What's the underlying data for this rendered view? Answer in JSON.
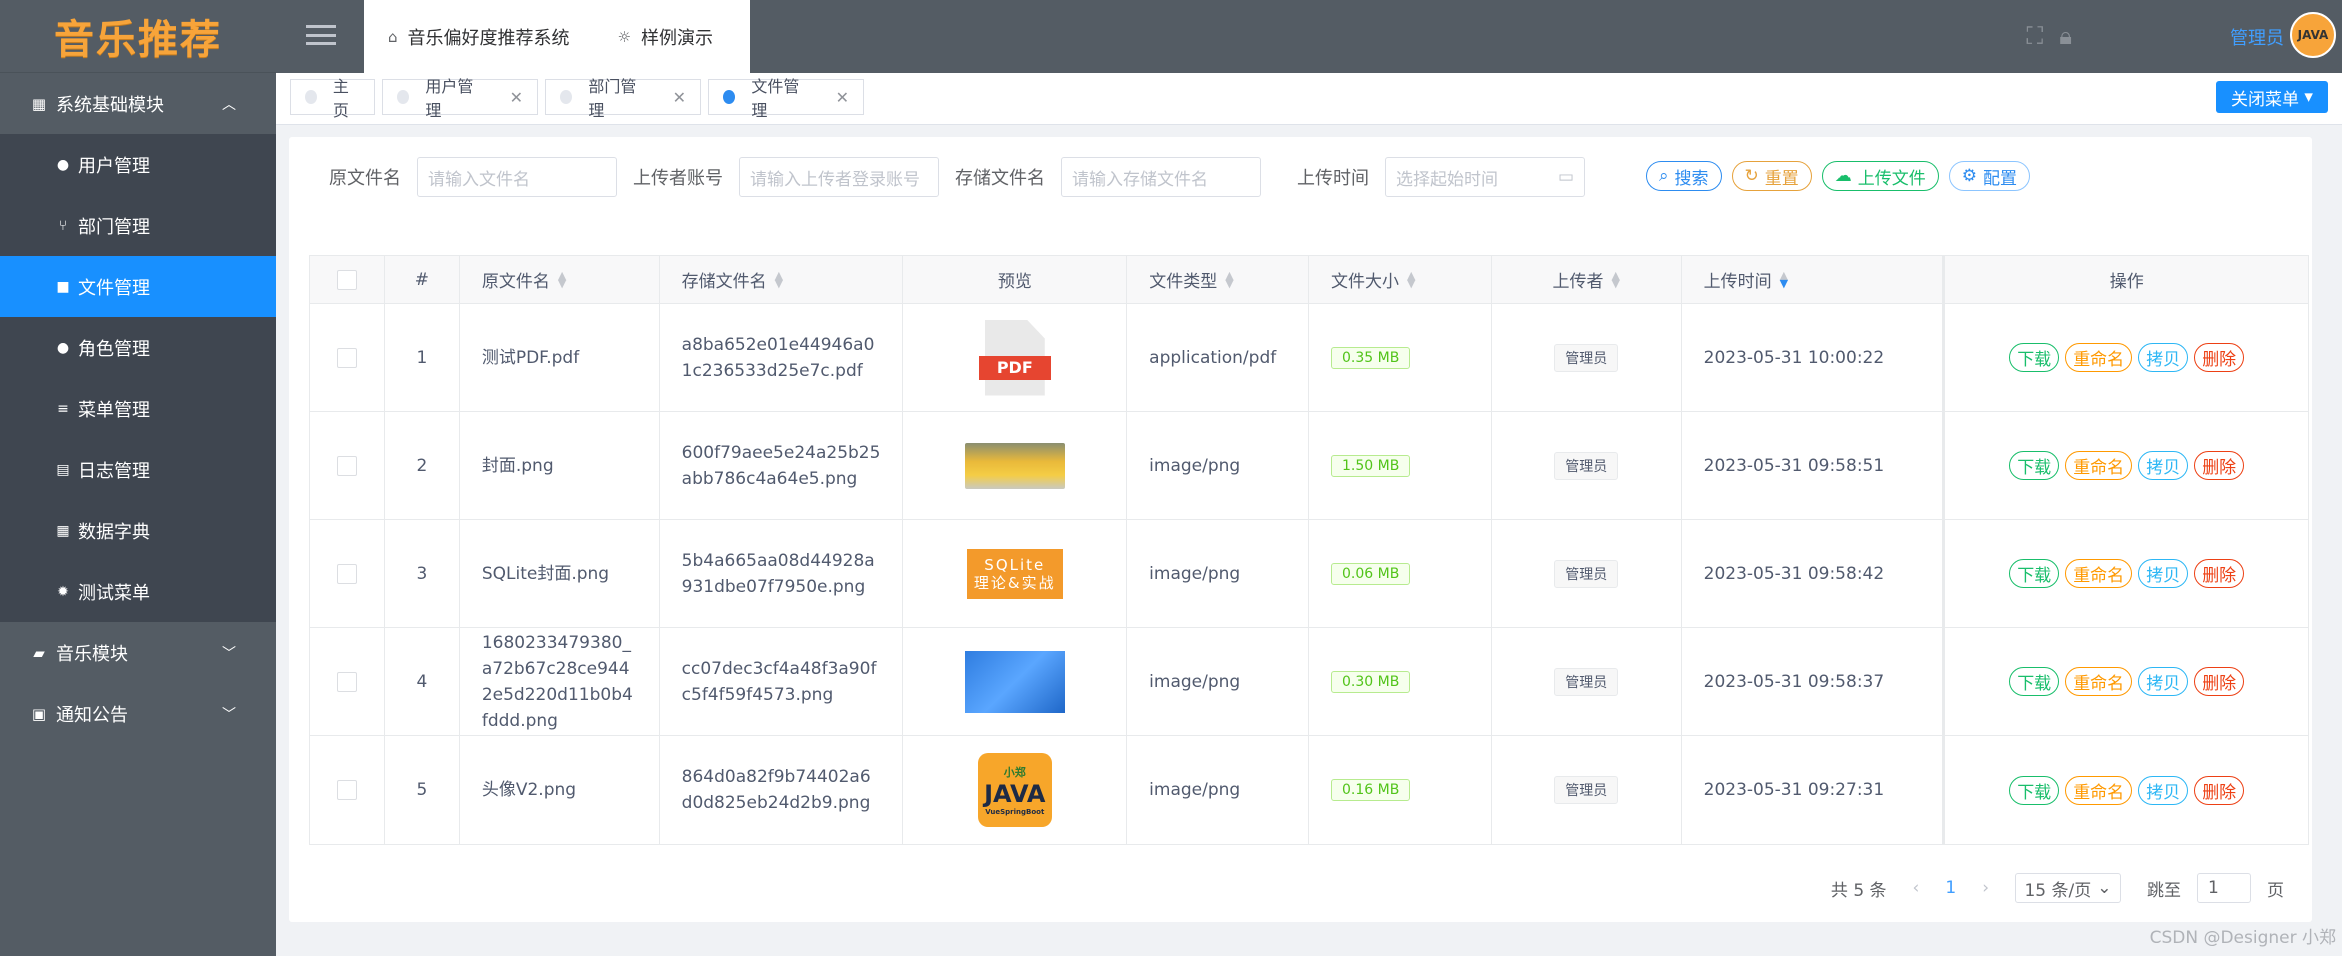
{
  "app": {
    "logo": "音乐推荐"
  },
  "top_nav": [
    {
      "label": "音乐偏好度推荐系统",
      "icon": "home-icon"
    },
    {
      "label": "样例演示",
      "icon": "bulb-icon"
    }
  ],
  "header": {
    "user": "管理员",
    "avatar_text": "JAVA"
  },
  "sidebar": {
    "group1": "系统基础模块",
    "items": [
      "用户管理",
      "部门管理",
      "文件管理",
      "角色管理",
      "菜单管理",
      "日志管理",
      "数据字典",
      "测试菜单"
    ],
    "group2": "音乐模块",
    "group3": "通知公告"
  },
  "tabs": [
    "主页",
    "用户管理",
    "部门管理",
    "文件管理"
  ],
  "close_menu": "关闭菜单",
  "search": {
    "name_label": "原文件名",
    "name_ph": "请输入文件名",
    "uploader_label": "上传者账号",
    "uploader_ph": "请输入上传者登录账号",
    "store_label": "存储文件名",
    "store_ph": "请输入存储文件名",
    "time_label": "上传时间",
    "time_ph": "选择起始时间",
    "btn_search": "搜索",
    "btn_reset": "重置",
    "btn_upload": "上传文件",
    "btn_config": "配置"
  },
  "table": {
    "headers": [
      "#",
      "原文件名",
      "存储文件名",
      "预览",
      "文件类型",
      "文件大小",
      "上传者",
      "上传时间",
      "操作"
    ],
    "rows": [
      {
        "idx": "1",
        "name": "测试PDF.pdf",
        "store": "a8ba652e01e44946a01c236533d25e7c.pdf",
        "type": "application/pdf",
        "size": "0.35 MB",
        "uploader": "管理员",
        "time": "2023-05-31 10:00:22"
      },
      {
        "idx": "2",
        "name": "封面.png",
        "store": "600f79aee5e24a25b25abb786c4a64e5.png",
        "type": "image/png",
        "size": "1.50 MB",
        "uploader": "管理员",
        "time": "2023-05-31 09:58:51"
      },
      {
        "idx": "3",
        "name": "SQLite封面.png",
        "store": "5b4a665aa08d44928a931dbe07f7950e.png",
        "type": "image/png",
        "size": "0.06 MB",
        "uploader": "管理员",
        "time": "2023-05-31 09:58:42"
      },
      {
        "idx": "4",
        "name": "1680233479380_a72b67c28ce9442e5d220d11b0b4fddd.png",
        "store": "cc07dec3cf4a48f3a90fc5f4f59f4573.png",
        "type": "image/png",
        "size": "0.30 MB",
        "uploader": "管理员",
        "time": "2023-05-31 09:58:37"
      },
      {
        "idx": "5",
        "name": "头像V2.png",
        "store": "864d0a82f9b74402a6d0d825eb24d2b9.png",
        "type": "image/png",
        "size": "0.16 MB",
        "uploader": "管理员",
        "time": "2023-05-31 09:27:31"
      }
    ],
    "ops": {
      "download": "下载",
      "rename": "重命名",
      "copy": "拷贝",
      "delete": "删除"
    },
    "preview_text": {
      "pdf": "PDF",
      "sqlite1": "SQLite",
      "sqlite2": "理论&实战",
      "java_top": "小郑",
      "java": "JAVA",
      "java_bottom": "VueSpringBoot"
    }
  },
  "pager": {
    "total": "共 5 条",
    "page": "1",
    "page_size": "15 条/页",
    "jump": "跳至",
    "jump_val": "1",
    "page_unit": "页"
  },
  "watermark": "CSDN @Designer 小郑"
}
